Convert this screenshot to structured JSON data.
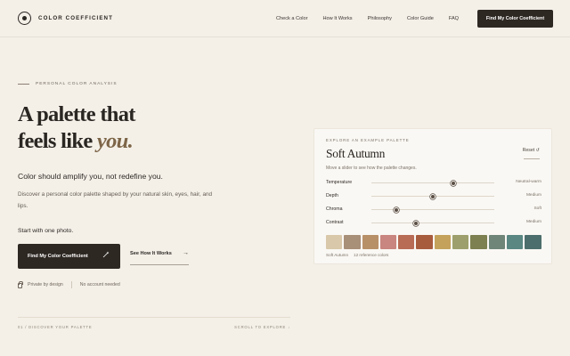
{
  "header": {
    "brand": "COLOR COEFFICIENT",
    "nav": [
      "Check a Color",
      "How It Works",
      "Philosophy",
      "Color Guide",
      "FAQ"
    ],
    "cta": "Find My Color Coefficient"
  },
  "hero": {
    "eyebrow": "PERSONAL COLOR ANALYSIS",
    "headline_1": "A palette that",
    "headline_2": "feels like ",
    "headline_em": "you.",
    "subhead": "Color should amplify you, not redefine you.",
    "description": "Discover a personal color palette shaped by your natural skin, eyes, hair, and lips.",
    "start_text": "Start with one photo.",
    "primary_button": "Find My Color Coefficient",
    "secondary_button": "See How It Works",
    "trust_1": "Private by design",
    "trust_2": "No account needed",
    "footer_left": "01 / DISCOVER YOUR PALETTE",
    "footer_right": "SCROLL TO EXPLORE ↓"
  },
  "card": {
    "eyebrow": "EXPLORE AN EXAMPLE PALETTE",
    "title": "Soft Autumn",
    "reset": "Reset ↺",
    "hint": "Move a slider to see how the palette changes.",
    "sliders": [
      {
        "label": "Temperature",
        "value_label": "Neutral-warm",
        "level": 0.67
      },
      {
        "label": "Depth",
        "value_label": "Medium",
        "level": 0.5
      },
      {
        "label": "Chroma",
        "value_label": "Soft",
        "level": 0.2
      },
      {
        "label": "Contrast",
        "value_label": "Medium",
        "level": 0.36
      }
    ],
    "swatches": [
      "#d9c8a9",
      "#a88f78",
      "#b89068",
      "#c9857f",
      "#b86b55",
      "#a85c3e",
      "#c4a25c",
      "#9da06c",
      "#7d8050",
      "#6f8578",
      "#5a8782",
      "#4c6e6c"
    ],
    "footer_name": "Soft Autumn",
    "footer_count": "12 reference colors"
  }
}
